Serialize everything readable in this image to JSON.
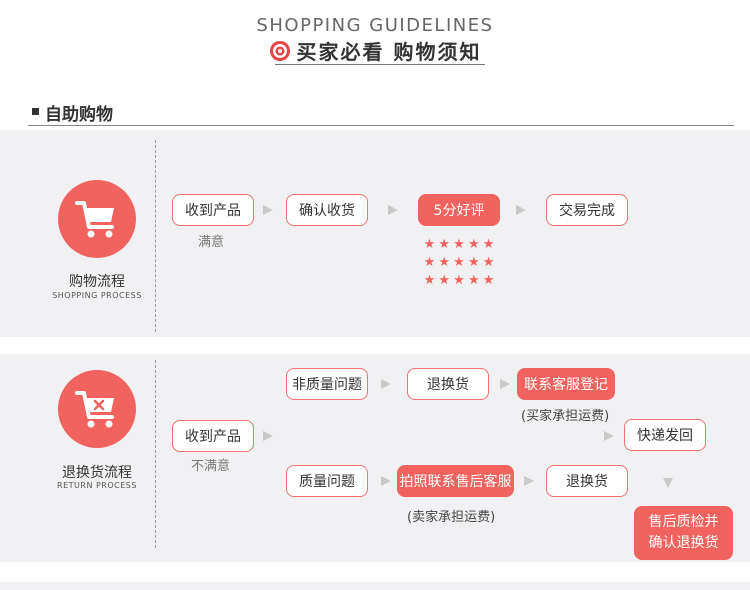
{
  "header": {
    "en_title": "SHOPPING GUIDELINES",
    "cn_title": "买家必看 购物须知",
    "icon": "target-icon"
  },
  "section": {
    "title": "自助购物"
  },
  "shopping": {
    "caption_cn": "购物流程",
    "caption_en": "SHOPPING PROCESS",
    "icon": "shopping-cart-icon",
    "steps": [
      "收到产品",
      "确认收货",
      "5分好评",
      "交易完成"
    ],
    "step1_sub": "满意",
    "star_count": 15
  },
  "returns": {
    "caption_cn": "退换货流程",
    "caption_en": "RETURN PROCESS",
    "icon": "return-cart-icon",
    "start": "收到产品",
    "start_sub": "不满意",
    "nonquality": "非质量问题",
    "exchange_top": "退换货",
    "register": "联系客服登记",
    "register_sub": "(买家承担运费)",
    "ship_back": "快递发回",
    "quality": "质量问题",
    "photo": "拍照联系售后客服",
    "photo_sub": "(卖家承担运费)",
    "exchange_bottom": "退换货",
    "after_check_line1": "售后质检并",
    "after_check_line2": "确认退换货"
  },
  "colors": {
    "accent": "#f2625f",
    "band": "#f1f1f3",
    "arrow": "#c9c9c9"
  }
}
